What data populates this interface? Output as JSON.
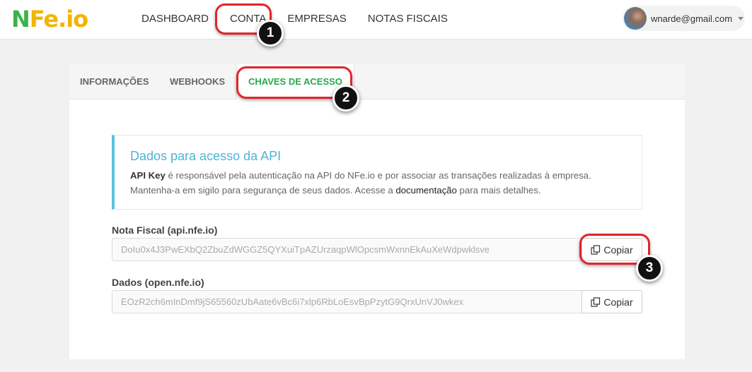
{
  "logo": {
    "n": "N",
    "rest": "Fe.io"
  },
  "nav": {
    "items": [
      "DASHBOARD",
      "CONTA",
      "EMPRESAS",
      "NOTAS FISCAIS"
    ]
  },
  "user": {
    "email": "wnarde@gmail.com"
  },
  "tabs": [
    "INFORMAÇÕES",
    "WEBHOOKS",
    "CHAVES DE ACESSO"
  ],
  "info": {
    "title": "Dados para acesso da API",
    "line1_bold": "API Key",
    "line1_rest": " é responsável pela autenticação na API do NFe.io e por associar as transações realizadas à empresa.",
    "line2_pre": "Mantenha-a em sigilo para segurança de seus dados. Acesse a ",
    "line2_link": "documentação",
    "line2_post": " para mais detalhes."
  },
  "fields": [
    {
      "label": "Nota Fiscal (api.nfe.io)",
      "value": "DoIu0x4J3PwEXbQ2ZbuZdWGGZ5QYXuiTpAZUrzaqpWlOpcsmWxnnEkAuXeWdpwklsve",
      "button": "Copiar"
    },
    {
      "label": "Dados (open.nfe.io)",
      "value": "EOzR2ch6mInDmf9jS65560zUbAate6vBc6i7xlp6RbLoEsvBpPzytG9QrxUnVJ0wkex",
      "button": "Copiar"
    }
  ],
  "annotations": [
    "1",
    "2",
    "3"
  ],
  "colors": {
    "brand_green": "#3bb34a",
    "brand_yellow": "#f4b400",
    "active_tab": "#2aa84a",
    "info_accent": "#5bc0de",
    "highlight": "#e0252b"
  }
}
